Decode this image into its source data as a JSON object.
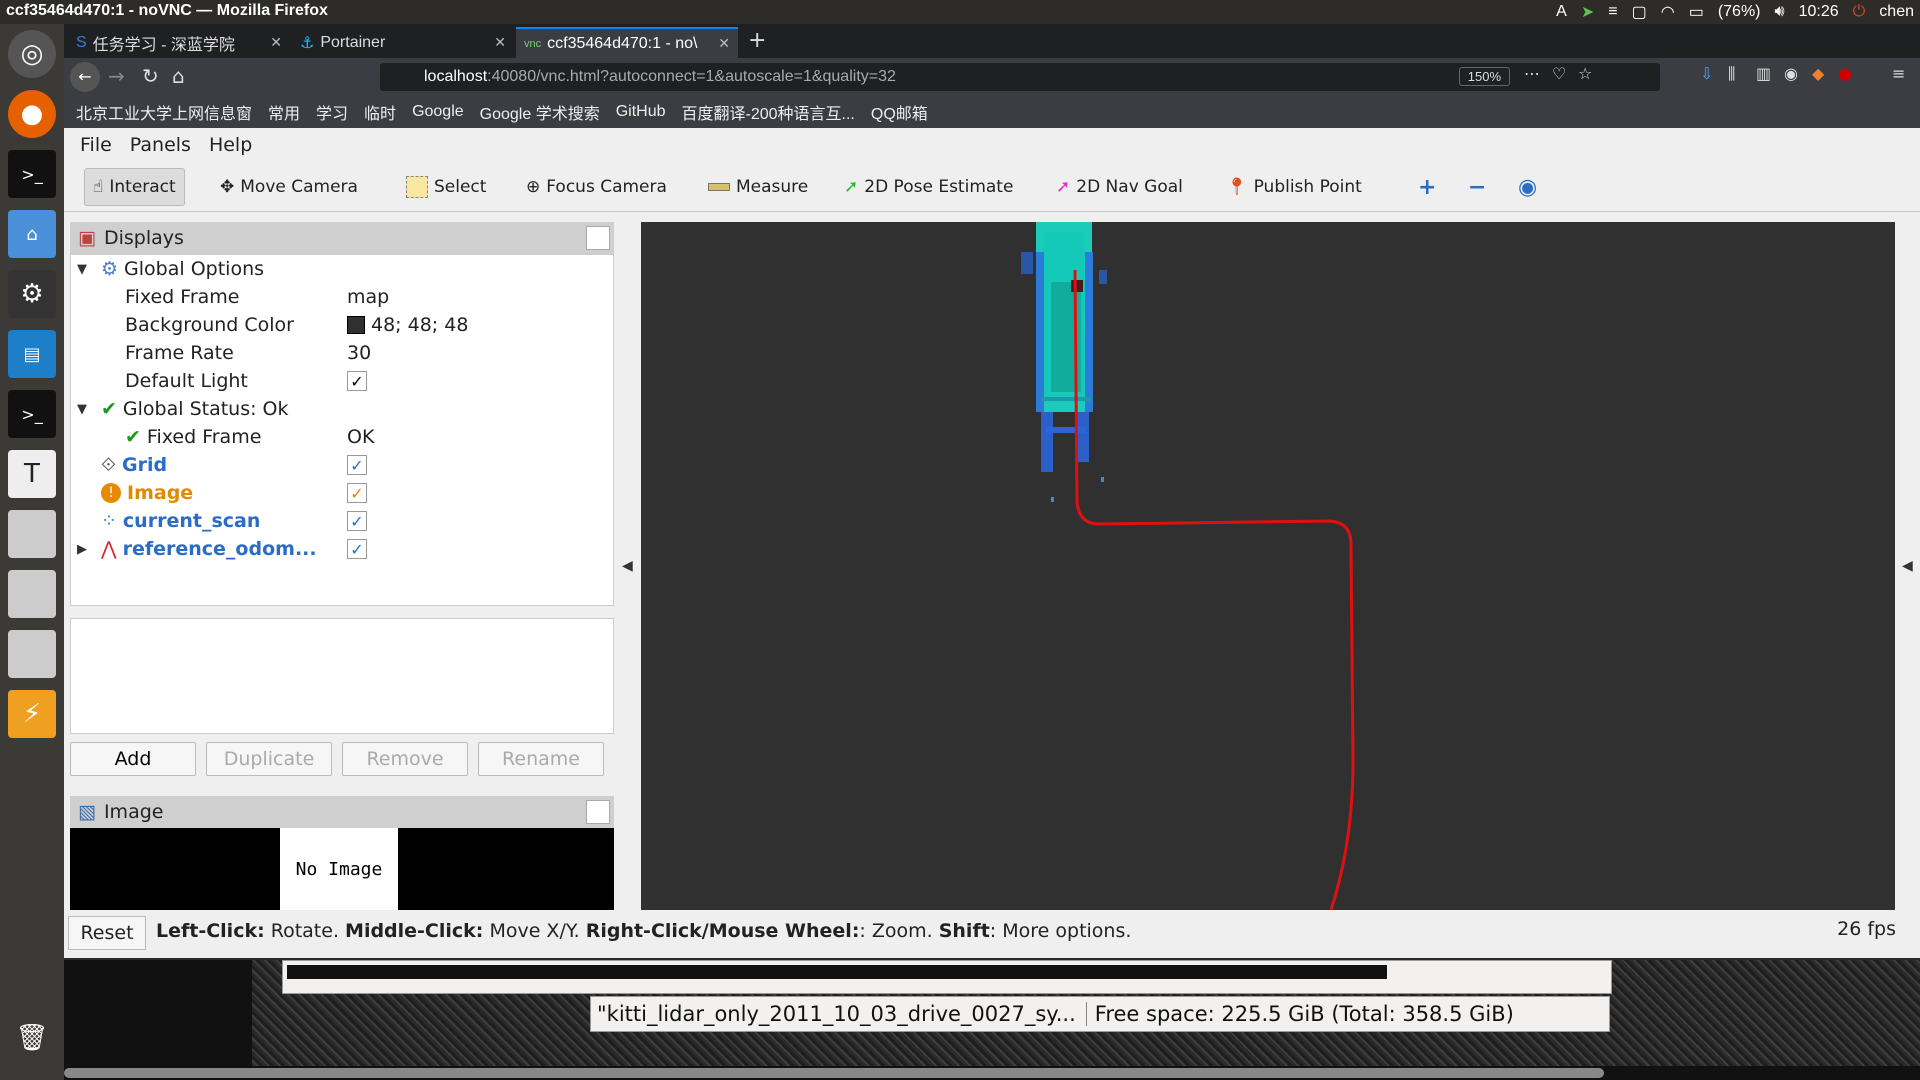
{
  "os_panel": {
    "window_title": "ccf35464d470:1 - noVNC — Mozilla Firefox",
    "battery": "(76%)",
    "time": "10:26",
    "user": "chen"
  },
  "browser": {
    "tabs": [
      {
        "label": "任务学习 - 深蓝学院"
      },
      {
        "label": "Portainer"
      },
      {
        "label": "ccf35464d470:1 - no\\"
      }
    ],
    "url_host": "localhost",
    "url_rest": ":40080/vnc.html?autoconnect=1&autoscale=1&quality=32",
    "zoom": "150%",
    "bookmarks": [
      "北京工业大学上网信息窗",
      "常用",
      "学习",
      "临时",
      "Google",
      "Google 学术搜索",
      "GitHub",
      "百度翻译-200种语言互...",
      "QQ邮箱"
    ]
  },
  "rviz": {
    "menu": [
      "File",
      "Panels",
      "Help"
    ],
    "tools": [
      "Interact",
      "Move Camera",
      "Select",
      "Focus Camera",
      "Measure",
      "2D Pose Estimate",
      "2D Nav Goal",
      "Publish Point"
    ],
    "displays_title": "Displays",
    "tree": {
      "global_options": "Global Options",
      "fixed_frame_label": "Fixed Frame",
      "fixed_frame_value": "map",
      "bg_color_label": "Background Color",
      "bg_color_value": "48; 48; 48",
      "frame_rate_label": "Frame Rate",
      "frame_rate_value": "30",
      "default_light_label": "Default Light",
      "global_status": "Global Status: Ok",
      "status_fixed_frame": "Fixed Frame",
      "status_fixed_frame_value": "OK",
      "grid": "Grid",
      "image": "Image",
      "current_scan": "current_scan",
      "reference_odom": "reference_odom..."
    },
    "buttons": {
      "add": "Add",
      "duplicate": "Duplicate",
      "remove": "Remove",
      "rename": "Rename"
    },
    "image_panel_title": "Image",
    "no_image": "No Image",
    "status": {
      "reset": "Reset",
      "lc_b": "Left-Click:",
      "lc": " Rotate. ",
      "mc_b": "Middle-Click:",
      "mc": " Move X/Y. ",
      "rc_b": "Right-Click/Mouse Wheel:",
      "rc": ": Zoom. ",
      "sh_b": "Shift",
      "sh": ": More options.",
      "fps": "26 fps"
    }
  },
  "file_manager": {
    "selected": "\"kitti_lidar_only_2011_10_03_drive_0027_sy...",
    "free_space": "Free space: 225.5 GiB (Total: 358.5 GiB)"
  },
  "colors": {
    "accent": "#0a84ff",
    "path": "#e01010",
    "scan": "#19e6d2",
    "viewport_bg": "#303030"
  }
}
